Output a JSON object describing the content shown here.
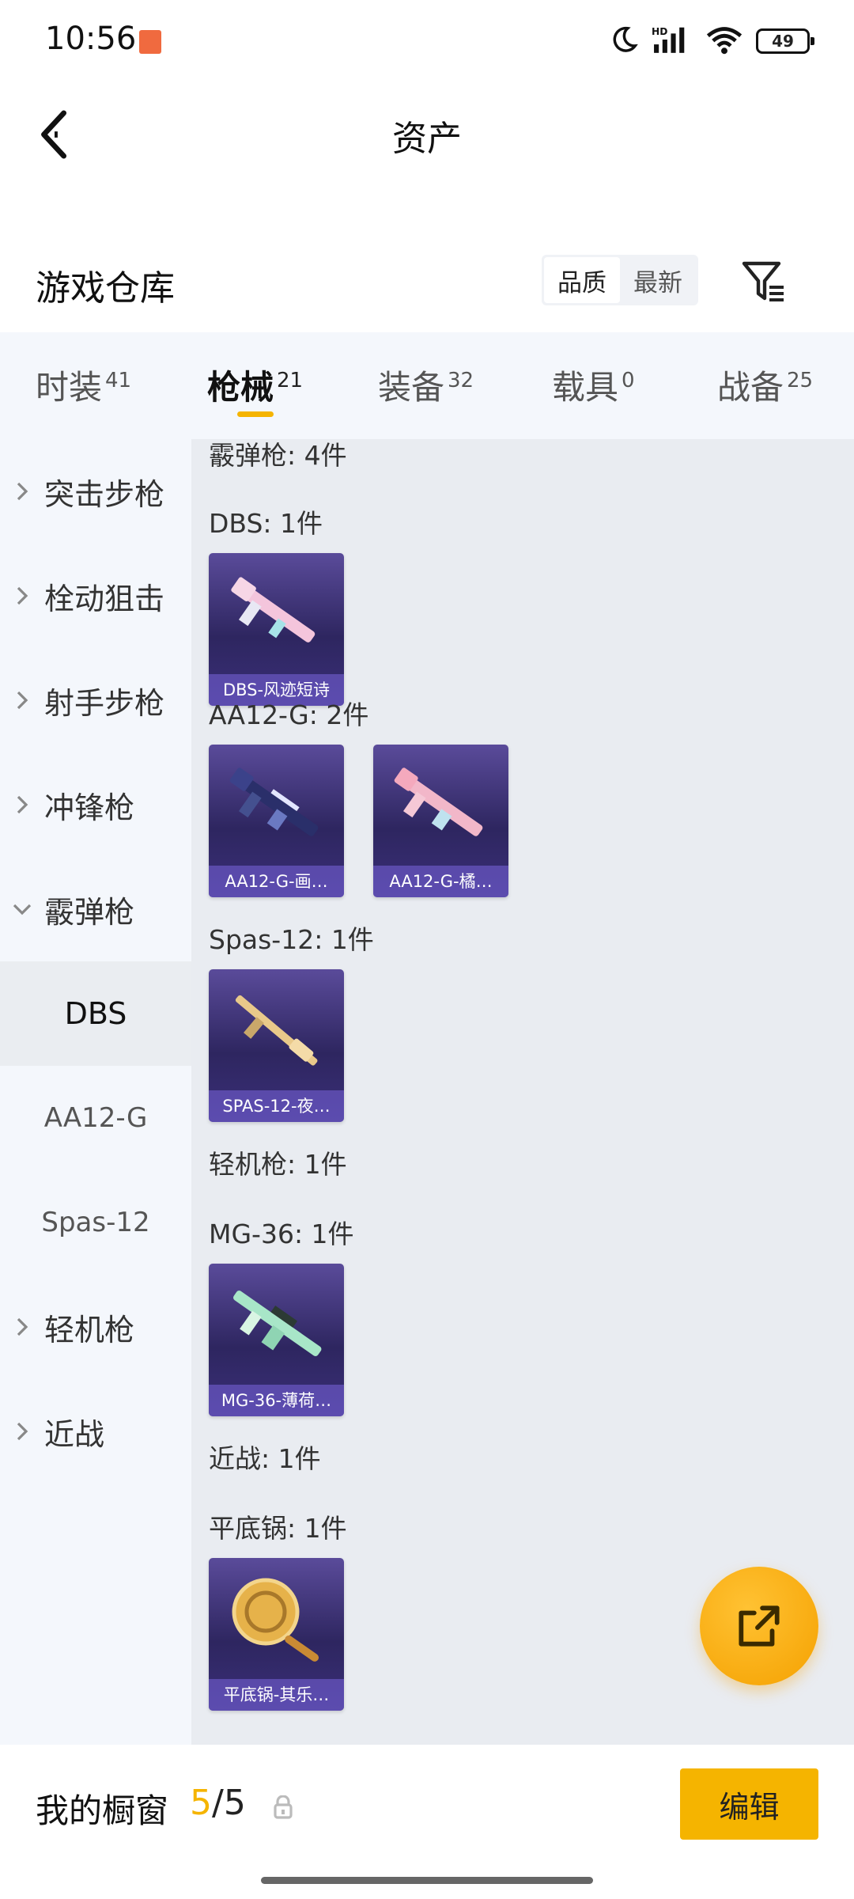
{
  "status_bar": {
    "time": "10:56",
    "battery": "49"
  },
  "header": {
    "title": "资产"
  },
  "warehouse": {
    "title": "游戏仓库",
    "sort_options": [
      "品质",
      "最新"
    ]
  },
  "tabs": [
    {
      "label": "时装",
      "count": "41"
    },
    {
      "label": "枪械",
      "count": "21"
    },
    {
      "label": "装备",
      "count": "32"
    },
    {
      "label": "载具",
      "count": "0"
    },
    {
      "label": "战备",
      "count": "25"
    }
  ],
  "sidebar": {
    "categories": [
      "突击步枪",
      "栓动狙击",
      "射手步枪",
      "冲锋枪",
      "霰弹枪",
      "轻机枪",
      "近战"
    ],
    "subitems": [
      "DBS",
      "AA12-G",
      "Spas-12"
    ]
  },
  "content": {
    "groups": [
      "霰弹枪: 4件",
      "DBS: 1件",
      "AA12-G: 2件",
      "Spas-12: 1件",
      "轻机枪: 1件",
      "MG-36: 1件",
      "近战: 1件",
      "平底锅: 1件"
    ],
    "items": [
      "DBS-风迹短诗",
      "AA12-G-画…",
      "AA12-G-橘…",
      "SPAS-12-夜…",
      "MG-36-薄荷…",
      "平底锅-其乐…"
    ]
  },
  "bottom": {
    "window_label": "我的橱窗",
    "count_current": "5",
    "count_separator": "/",
    "count_total": "5",
    "edit_label": "编辑"
  },
  "colors": {
    "accent": "#f5b400",
    "sidebar_bg": "#f4f7fc",
    "content_bg": "#e9ecf1",
    "card_bg": "#2e2660"
  }
}
